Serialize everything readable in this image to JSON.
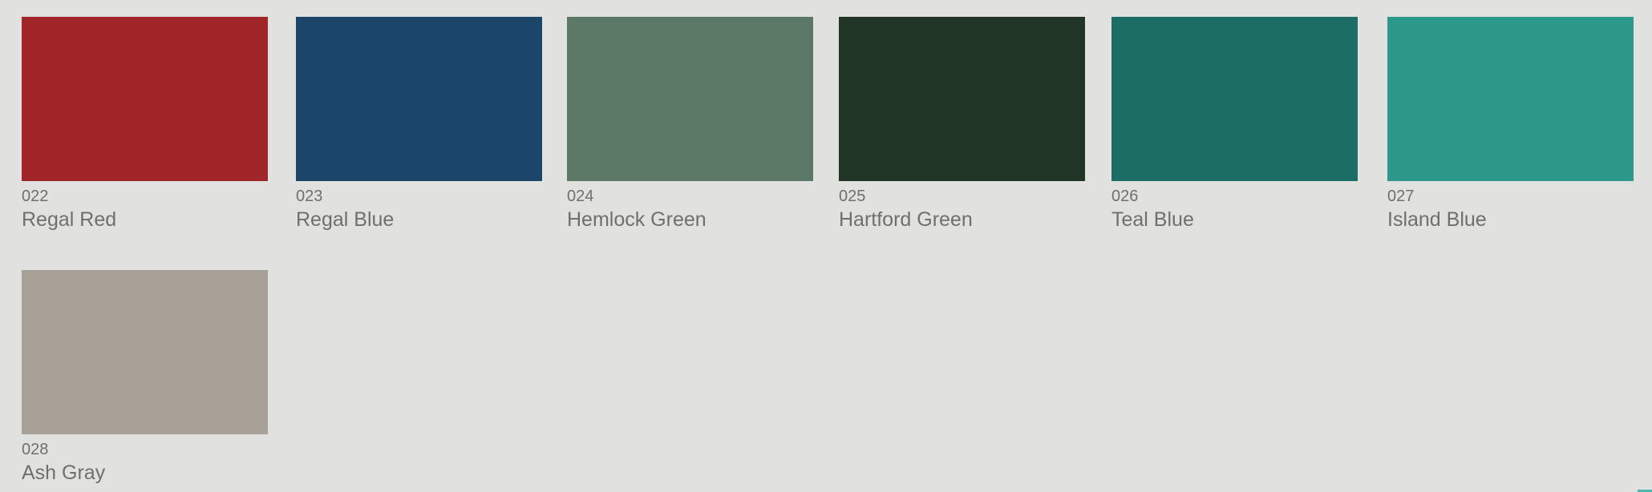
{
  "swatches": [
    {
      "code": "022",
      "name": "Regal Red",
      "color": "#a0262a"
    },
    {
      "code": "023",
      "name": "Regal Blue",
      "color": "#1c4669"
    },
    {
      "code": "024",
      "name": "Hemlock Green",
      "color": "#5c7967"
    },
    {
      "code": "025",
      "name": "Hartford Green",
      "color": "#213526"
    },
    {
      "code": "026",
      "name": "Teal Blue",
      "color": "#1c6e64"
    },
    {
      "code": "027",
      "name": "Island Blue",
      "color": "#2d998b"
    },
    {
      "code": "028",
      "name": "Ash Gray",
      "color": "#a7a197"
    }
  ],
  "accent": "#4fb6b0"
}
